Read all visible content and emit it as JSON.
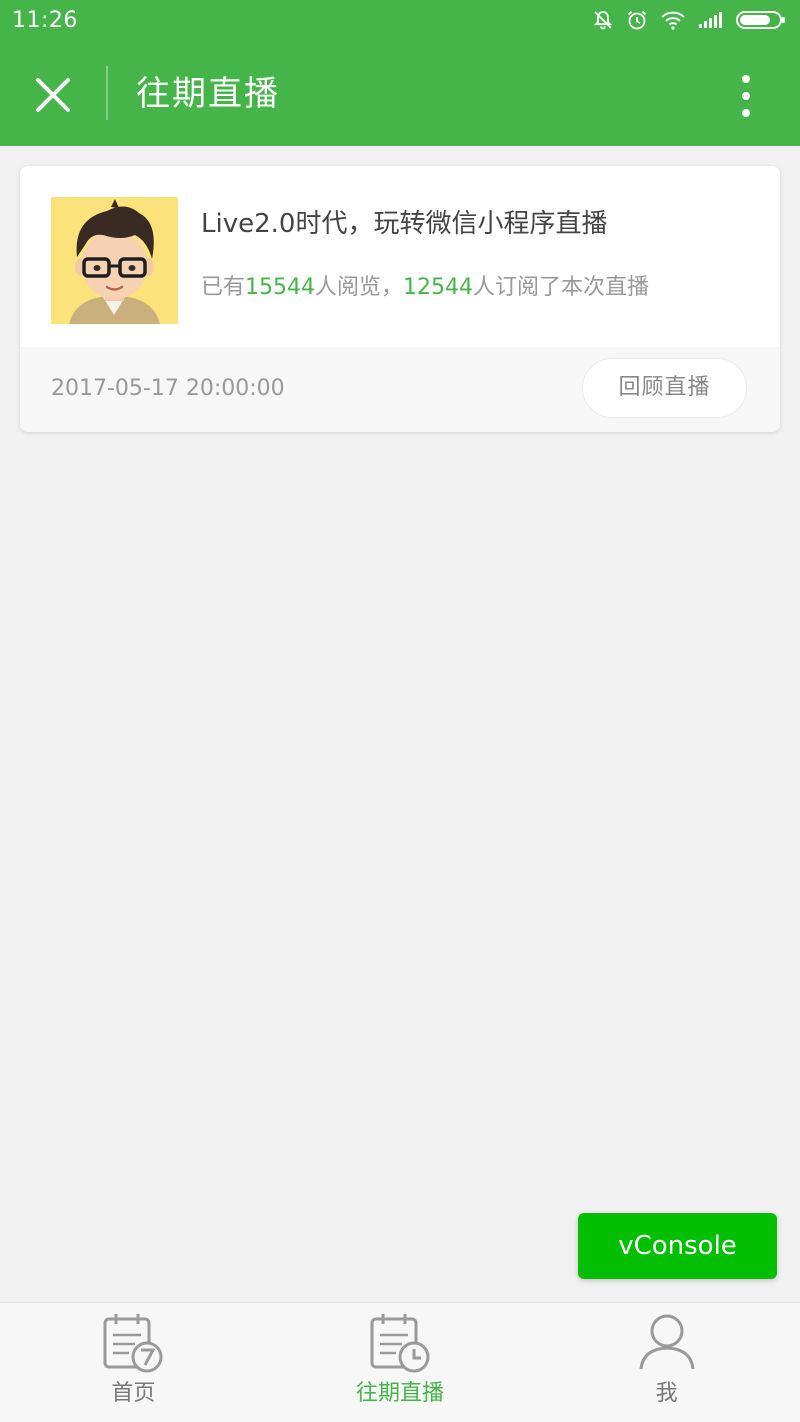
{
  "status_bar": {
    "time": "11:26",
    "icons": [
      "bell-muted-icon",
      "alarm-icon",
      "wifi-icon",
      "signal-icon",
      "battery-icon"
    ]
  },
  "nav": {
    "title": "往期直播",
    "close_icon": "close-icon",
    "more_icon": "more-vertical-icon"
  },
  "live_card": {
    "title": "Live2.0时代，玩转微信小程序直播",
    "stats": {
      "prefix": "已有",
      "views": "15544",
      "views_suffix": "人阅览，",
      "subscribers": "12544",
      "subscribers_suffix": "人订阅了本次直播"
    },
    "date": "2017-05-17 20:00:00",
    "replay_button": "回顾直播"
  },
  "vconsole": {
    "label": "vConsole"
  },
  "tabs": [
    {
      "label": "首页",
      "icon": "calendar-icon",
      "active": false
    },
    {
      "label": "往期直播",
      "icon": "calendar-clock-icon",
      "active": true
    },
    {
      "label": "我",
      "icon": "user-icon",
      "active": false
    }
  ],
  "colors": {
    "brand_green": "#46b549",
    "vconsole_green": "#04be02",
    "background": "#f1f1f1"
  }
}
